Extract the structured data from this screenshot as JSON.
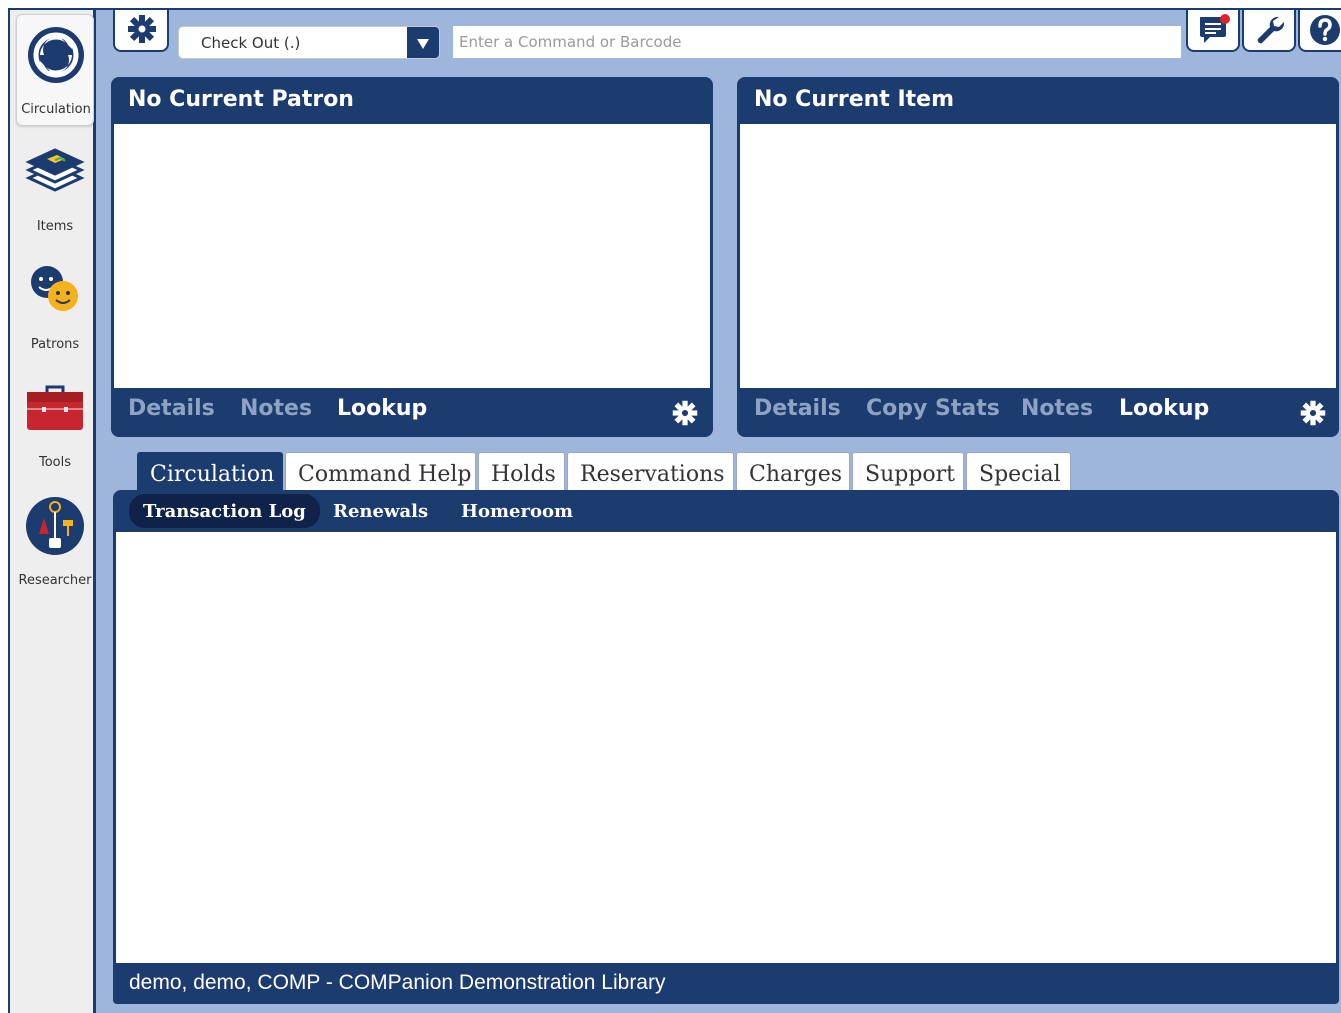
{
  "sidebar": {
    "items": [
      {
        "label": "Circulation",
        "icon": "circulation-icon",
        "active": true
      },
      {
        "label": "Items",
        "icon": "books-icon",
        "active": false
      },
      {
        "label": "Patrons",
        "icon": "patrons-icon",
        "active": false
      },
      {
        "label": "Tools",
        "icon": "toolbox-icon",
        "active": false
      },
      {
        "label": "Researcher",
        "icon": "researcher-icon",
        "active": false
      }
    ]
  },
  "toolbar": {
    "settings_icon": "gear-icon",
    "mode_value": "Check Out (.)",
    "command_placeholder": "Enter a Command or Barcode",
    "right_icons": [
      "messages-icon",
      "wrench-icon",
      "help-icon"
    ]
  },
  "patron_panel": {
    "title": "No Current Patron",
    "tabs": [
      "Details",
      "Notes",
      "Lookup"
    ],
    "active_tab": "Lookup"
  },
  "item_panel": {
    "title": "No Current Item",
    "tabs": [
      "Details",
      "Copy Stats",
      "Notes",
      "Lookup"
    ],
    "active_tab": "Lookup"
  },
  "main_tabs": [
    "Circulation",
    "Command Help",
    "Holds",
    "Reservations",
    "Charges",
    "Support",
    "Special"
  ],
  "active_main_tab": "Circulation",
  "sub_tabs": [
    "Transaction Log",
    "Renewals",
    "Homeroom"
  ],
  "active_sub_tab": "Transaction Log",
  "status_text": "demo, demo, COMP - COMPanion Demonstration Library",
  "colors": {
    "navy": "#1c3b6e",
    "background": "#9fb6dc",
    "inactive_tab_text": "#8ea3c4"
  }
}
